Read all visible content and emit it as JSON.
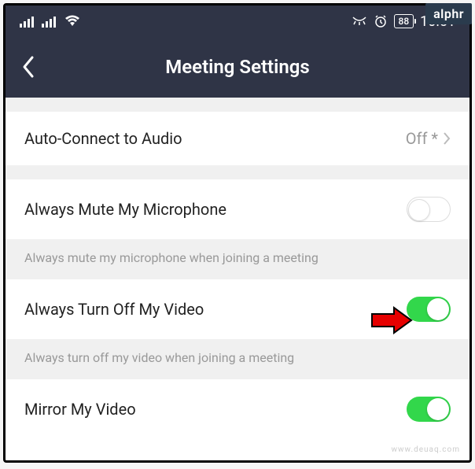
{
  "statusBar": {
    "battery": "88",
    "time": "10:51"
  },
  "header": {
    "title": "Meeting Settings"
  },
  "settings": {
    "autoConnect": {
      "label": "Auto-Connect to Audio",
      "value": "Off *"
    },
    "muteMic": {
      "label": "Always Mute My Microphone",
      "description": "Always mute my microphone when joining a meeting",
      "enabled": false
    },
    "turnOffVideo": {
      "label": "Always Turn Off My Video",
      "description": "Always turn off my video when joining a meeting",
      "enabled": true
    },
    "mirrorVideo": {
      "label": "Mirror My Video",
      "enabled": true
    }
  },
  "badge": "alphr",
  "watermark": "www.deuaq.com"
}
